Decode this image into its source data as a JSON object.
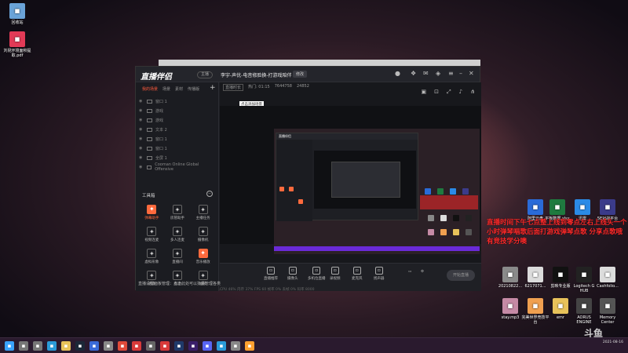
{
  "desktop": {
    "icons_left": [
      {
        "label": "回收站",
        "icon": "recycle-bin-icon",
        "color": "#6aa3d8"
      },
      {
        "label": "刘昆环境面积提取.pdf",
        "icon": "pdf-icon",
        "color": "#e23a57"
      }
    ],
    "icons_right": [
      {
        "label": "阿里云盘",
        "icon": "cloud-icon",
        "color": "#2a6bd8"
      },
      {
        "label": "平板数据.xlsx",
        "icon": "excel-icon",
        "color": "#1f7a3f"
      },
      {
        "label": "迅雷",
        "icon": "thunder-icon",
        "color": "#2b8ae6"
      },
      {
        "label": "5E对战平台",
        "icon": "game-icon",
        "color": "#3b3b8a"
      },
      {
        "label": "20210822...",
        "icon": "image-icon",
        "color": "#8a8a8a"
      },
      {
        "label": "6217071...",
        "icon": "file-icon",
        "color": "#dcdcdc"
      },
      {
        "label": "剪映专业版",
        "icon": "capcut-icon",
        "color": "#111111"
      },
      {
        "label": "Logitech G HUB",
        "icon": "logitech-icon",
        "color": "#222222"
      },
      {
        "label": "Cashfolio...",
        "icon": "doc-icon",
        "color": "#dcdcdc"
      },
      {
        "label": "stay.mp3",
        "icon": "music-icon",
        "color": "#c58aa5"
      },
      {
        "label": "完美世界竞技平台",
        "icon": "perfect-world-icon",
        "color": "#f0a050"
      },
      {
        "label": "emr",
        "icon": "folder-icon",
        "color": "#e8c25a"
      },
      {
        "label": "AORUS ENGINE",
        "icon": "aorus-icon",
        "color": "#444444"
      },
      {
        "label": "Memory Center",
        "icon": "memory-icon",
        "color": "#555555"
      }
    ]
  },
  "app": {
    "logo": "直播伴侣",
    "version_badge": "主播",
    "stream_title": "李宇-声优-电音修脸换-打游戏陪伴",
    "modify_button": "修改",
    "tabs": [
      "我的场景",
      "场景",
      "素材",
      "传播版"
    ],
    "sources": [
      "窗口 1",
      "游戏",
      "游戏",
      "文本 2",
      "窗口 1",
      "窗口 1",
      "全屏 1",
      "Cooman Online Global Offensive"
    ],
    "toolbox_title": "工具箱",
    "tools": [
      {
        "label": "弹幕助手",
        "icon": "barrage-icon",
        "style": "orange",
        "active": true
      },
      {
        "label": "房管助手",
        "icon": "admin-icon",
        "style": "plain"
      },
      {
        "label": "主播任务",
        "icon": "task-icon",
        "style": "plain"
      },
      {
        "label": "视频连麦",
        "icon": "video-link-icon",
        "style": "plain"
      },
      {
        "label": "多人连麦",
        "icon": "multi-link-icon",
        "style": "plain"
      },
      {
        "label": "摄像机",
        "icon": "camera-icon",
        "style": "plain"
      },
      {
        "label": "虚拟形象",
        "icon": "avatar-icon",
        "style": "plain"
      },
      {
        "label": "直播间",
        "icon": "live-room-icon",
        "style": "plain"
      },
      {
        "label": "音乐播放",
        "icon": "music-play-icon",
        "style": "orange"
      },
      {
        "label": "更多",
        "icon": "more-icon",
        "style": "plain"
      },
      {
        "label": "互动",
        "icon": "interact-icon",
        "style": "plain"
      },
      {
        "label": "福袋",
        "icon": "gift-bag-icon",
        "style": "plain"
      }
    ],
    "info_row": [
      "直播时长",
      "热门: 01:15",
      "7644758",
      "24852"
    ],
    "tooltip": "点击添加场景",
    "notice": "直播设置面板管理：点击此处可以批量管理各类",
    "bottom_buttons": [
      {
        "label": "直播推荐",
        "icon": "recommend-icon"
      },
      {
        "label": "摄像头",
        "icon": "webcam-icon"
      },
      {
        "label": "多机位直播",
        "icon": "multi-cam-icon"
      },
      {
        "label": "录视频",
        "icon": "record-icon"
      },
      {
        "label": "麦克风",
        "icon": "mic-icon"
      },
      {
        "label": "扬声器",
        "icon": "speaker-icon"
      }
    ],
    "go_live": "开始直播",
    "stats": "CPU 46%  内存 37%  FPS 60  帧率 0%  丢帧 0%  码率 8000"
  },
  "overlay": {
    "text": "直播时间下午七点整上线到零点左右上线头一个小时弹琴唱歌后面打游戏弹琴点歌 分享点歌哦 有竞技学分噢",
    "color": "#ff2a2a"
  },
  "watermark": {
    "logo": "斗鱼",
    "url": "DOUYU.COM"
  },
  "taskbar": {
    "icons": [
      {
        "name": "windows-icon",
        "color": "#3aa3ff"
      },
      {
        "name": "search-icon",
        "color": "#777"
      },
      {
        "name": "task-view-icon",
        "color": "#777"
      },
      {
        "name": "edge-icon",
        "color": "#2b9bd8"
      },
      {
        "name": "explorer-icon",
        "color": "#e8c25a"
      },
      {
        "name": "steam-icon",
        "color": "#1b2838"
      },
      {
        "name": "app1-icon",
        "color": "#3a6ad8"
      },
      {
        "name": "app2-icon",
        "color": "#888"
      },
      {
        "name": "chrome-icon",
        "color": "#e04a3a"
      },
      {
        "name": "music-app-icon",
        "color": "#d83a3a"
      },
      {
        "name": "app3-icon",
        "color": "#666"
      },
      {
        "name": "netease-icon",
        "color": "#d83a3a"
      },
      {
        "name": "photoshop-icon",
        "color": "#1f3a6a"
      },
      {
        "name": "premiere-icon",
        "color": "#3a1f6a"
      },
      {
        "name": "discord-icon",
        "color": "#5865f2"
      },
      {
        "name": "app4-icon",
        "color": "#2a9ad8"
      },
      {
        "name": "app5-icon",
        "color": "#888"
      },
      {
        "name": "app6-icon",
        "color": "#ffa030"
      }
    ],
    "date": "2021-08-16"
  }
}
